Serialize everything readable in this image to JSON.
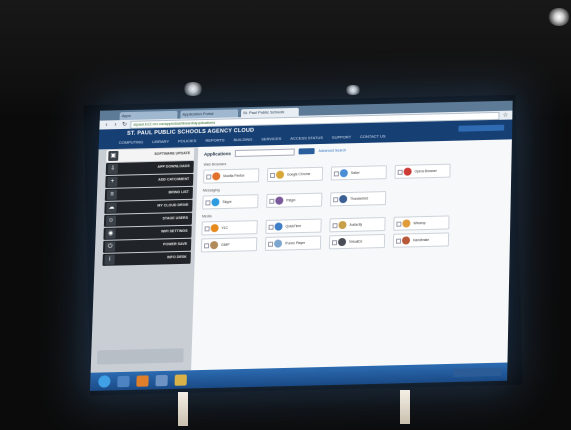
{
  "browser": {
    "tabs": [
      "Apps",
      "Application Portal",
      "St. Paul Public Schools"
    ],
    "url": "stpaul.k12.mn.us/apps/dashboard/applications"
  },
  "site": {
    "title": "ST. PAUL PUBLIC SCHOOLS AGENCY CLOUD",
    "menu": [
      "COMPUTING",
      "LIBRARY",
      "POLICIES",
      "REPORTS",
      "BUILDING",
      "SERVICES",
      "ACCESS STATUS",
      "SUPPORT",
      "CONTACT US"
    ]
  },
  "sidebar": {
    "items": [
      "SOFTWARE UPDATE",
      "APP DOWNLOADS",
      "ADD CATCHMENT",
      "BRING LIST",
      "MY CLOUD DRIVE",
      "STAGE USERS",
      "WIFI SETTINGS",
      "POWER SAVE",
      "INFO DESK"
    ]
  },
  "main": {
    "heading": "Applications",
    "link": "Advanced Search",
    "categories": [
      {
        "name": "Web Browsers",
        "apps": [
          "Mozilla Firefox",
          "Google Chrome",
          "Safari",
          "Opera Browser"
        ]
      },
      {
        "name": "Messaging",
        "apps": [
          "Skype",
          "Pidgin",
          "Thunderbird"
        ]
      },
      {
        "name": "Media",
        "apps": [
          "VLC",
          "QuickTime",
          "Audacity",
          "Winamp",
          "GIMP",
          "iTunes Player",
          "VirtualDJ",
          "Handbrake"
        ]
      }
    ]
  },
  "colors": {
    "site_bar": "#163f74",
    "taskbar": "#1a4a86",
    "accent": "#2a5d9b"
  }
}
